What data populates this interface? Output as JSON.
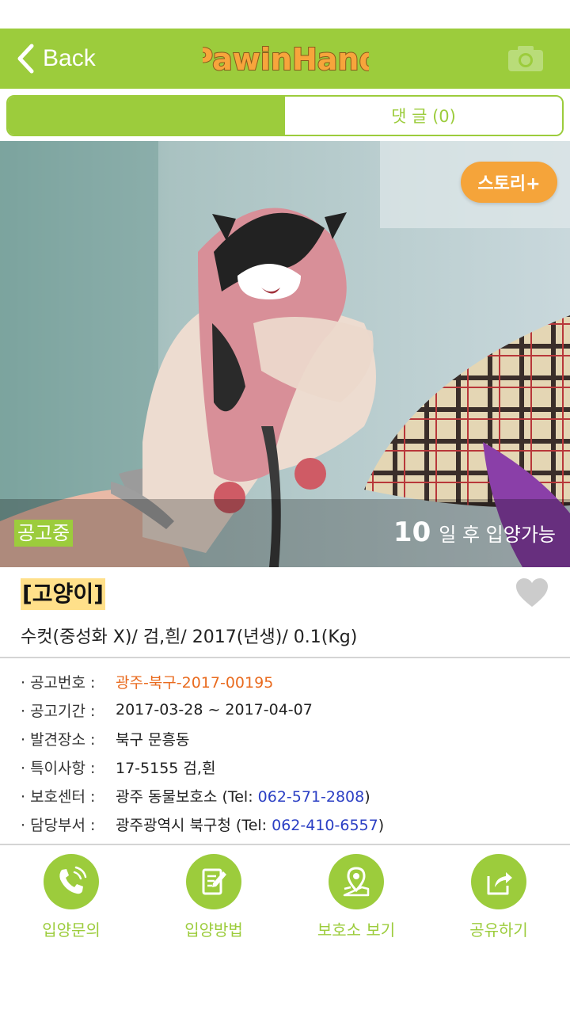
{
  "app": {
    "logo_text": "PawinHand"
  },
  "nav": {
    "back_label": "Back",
    "back_icon": "chevron-left-icon",
    "camera_icon": "camera-icon"
  },
  "tabs": {
    "comments_label": "댓 글 (0)"
  },
  "photo": {
    "story_button": "스토리+",
    "status_badge": "공고중",
    "days_number": "10",
    "days_suffix": "일 후 입양가능"
  },
  "animal": {
    "title": "[고양이]",
    "summary": "수컷(중성화 X)/ 검,흰/ 2017(년생)/ 0.1(Kg)",
    "favorite_icon": "heart-icon"
  },
  "details": [
    {
      "label": "· 공고번호 :",
      "value": "광주-북구-2017-00195",
      "tel": "",
      "suffix": ""
    },
    {
      "label": "· 공고기간 :",
      "value": "2017-03-28 ~ 2017-04-07",
      "tel": "",
      "suffix": ""
    },
    {
      "label": "· 발견장소 :",
      "value": "북구 문흥동",
      "tel": "",
      "suffix": ""
    },
    {
      "label": "· 특이사항 :",
      "value": "17-5155 검,흰",
      "tel": "",
      "suffix": ""
    },
    {
      "label": "· 보호센터 :",
      "value": "광주 동물보호소 (Tel: ",
      "tel": "062-571-2808",
      "suffix": ")"
    },
    {
      "label": "· 담당부서 :",
      "value": "광주광역시 북구청 (Tel: ",
      "tel": "062-410-6557",
      "suffix": ")"
    }
  ],
  "actions": [
    {
      "label": "입양문의",
      "icon": "phone-icon"
    },
    {
      "label": "입양방법",
      "icon": "edit-document-icon"
    },
    {
      "label": "보호소 보기",
      "icon": "map-pin-icon"
    },
    {
      "label": "공유하기",
      "icon": "share-icon"
    }
  ],
  "colors": {
    "brand_green": "#9ccc3c",
    "story_orange": "#f5a43a",
    "notice_orange": "#e96b1f",
    "tel_blue": "#2b3fc4",
    "title_highlight": "#ffe08a"
  }
}
